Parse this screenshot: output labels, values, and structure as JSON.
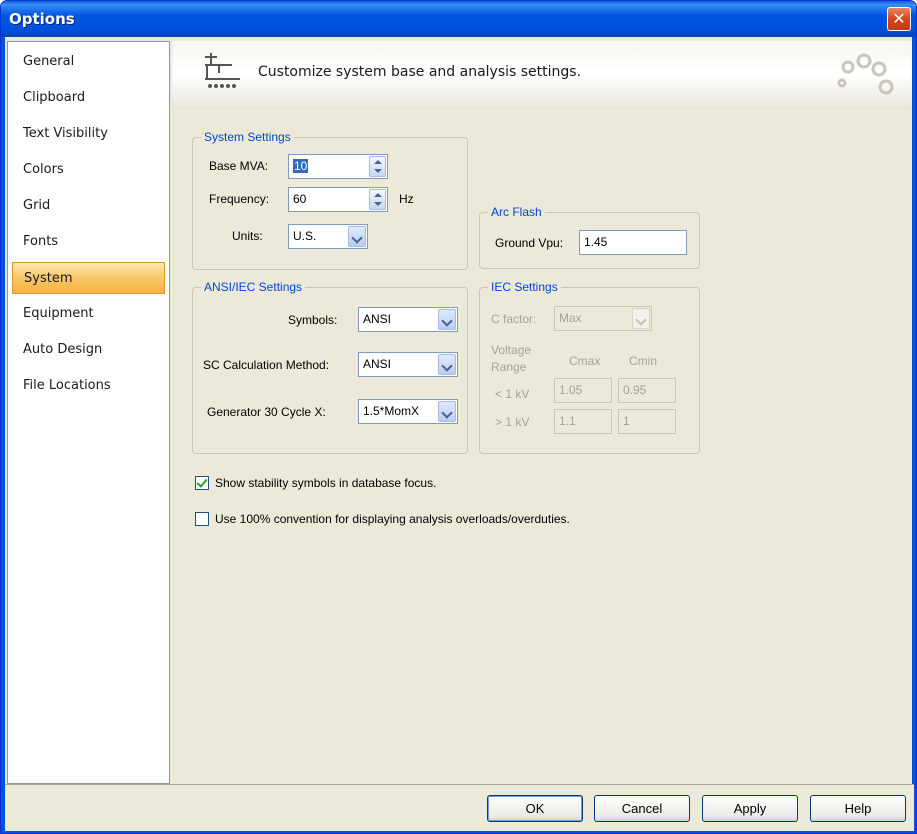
{
  "window": {
    "title": "Options",
    "close_glyph": "✕"
  },
  "nav": {
    "items": [
      {
        "label": "General",
        "selected": false
      },
      {
        "label": "Clipboard",
        "selected": false
      },
      {
        "label": "Text Visibility",
        "selected": false
      },
      {
        "label": "Colors",
        "selected": false
      },
      {
        "label": "Grid",
        "selected": false
      },
      {
        "label": "Fonts",
        "selected": false
      },
      {
        "label": "System",
        "selected": true
      },
      {
        "label": "Equipment",
        "selected": false
      },
      {
        "label": "Auto Design",
        "selected": false
      },
      {
        "label": "File Locations",
        "selected": false
      }
    ]
  },
  "banner": {
    "text": "Customize system base and analysis settings.",
    "icon": "network-bus-icon"
  },
  "system_settings": {
    "legend": "System Settings",
    "base_mva_label": "Base MVA:",
    "base_mva_value": "10",
    "frequency_label": "Frequency:",
    "frequency_value": "60",
    "frequency_unit": "Hz",
    "units_label": "Units:",
    "units_value": "U.S."
  },
  "arc_flash": {
    "legend": "Arc Flash",
    "ground_vpu_label": "Ground Vpu:",
    "ground_vpu_value": "1.45"
  },
  "ansi_iec": {
    "legend": "ANSI/IEC Settings",
    "symbols_label": "Symbols:",
    "symbols_value": "ANSI",
    "sc_method_label": "SC Calculation Method:",
    "sc_method_value": "ANSI",
    "gen_label": "Generator 30 Cycle X:",
    "gen_value": "1.5*MomX"
  },
  "iec_settings": {
    "legend": "IEC Settings",
    "c_factor_label": "C factor:",
    "c_factor_value": "Max",
    "voltage_label_1": "Voltage",
    "voltage_label_2": "Range",
    "cmax_label": "Cmax",
    "cmin_label": "Cmin",
    "lt_label": "< 1 kV",
    "gt_label": "> 1 kV",
    "lt_cmax": "1.05",
    "lt_cmin": "0.95",
    "gt_cmax": "1.1",
    "gt_cmin": "1"
  },
  "options": {
    "stability_label": "Show stability symbols in database focus.",
    "stability_checked": true,
    "convention_label": "Use 100% convention for displaying analysis overloads/overduties.",
    "convention_checked": false
  },
  "footer": {
    "ok": "OK",
    "cancel": "Cancel",
    "apply": "Apply",
    "help": "Help"
  },
  "colors": {
    "title_bar": "#0055e5",
    "legend_text": "#0046d5",
    "selected_nav": "#f8c768"
  }
}
